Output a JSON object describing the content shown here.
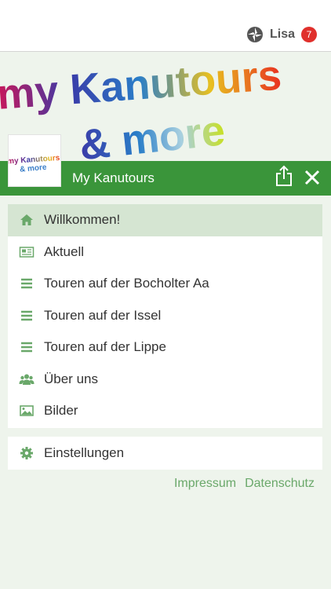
{
  "user": {
    "name": "Lisa",
    "badge_count": "7",
    "logo_icon": "app-swirl-icon"
  },
  "banner": {
    "line1": "my Kanutours",
    "line2": "& more",
    "logo_line1": "my Kanutours",
    "logo_line2": "& more"
  },
  "header": {
    "title": "My Kanutours",
    "share_icon": "share-icon",
    "close_icon": "close-icon"
  },
  "menu": {
    "items": [
      {
        "label": "Willkommen!",
        "icon": "home-icon",
        "active": true
      },
      {
        "label": "Aktuell",
        "icon": "newspaper-icon",
        "active": false
      },
      {
        "label": "Touren auf der Bocholter Aa",
        "icon": "list-icon",
        "active": false
      },
      {
        "label": "Touren auf der Issel",
        "icon": "list-icon",
        "active": false
      },
      {
        "label": "Touren auf der Lippe",
        "icon": "list-icon",
        "active": false
      },
      {
        "label": "Über uns",
        "icon": "group-icon",
        "active": false
      },
      {
        "label": "Bilder",
        "icon": "image-icon",
        "active": false
      }
    ]
  },
  "settings": {
    "label": "Einstellungen",
    "icon": "gear-icon"
  },
  "footer": {
    "impressum": "Impressum",
    "datenschutz": "Datenschutz"
  },
  "colors": {
    "accent": "#3a953a",
    "icon": "#6aa86a",
    "active_bg": "#d5e5d2",
    "badge": "#e0302c"
  }
}
